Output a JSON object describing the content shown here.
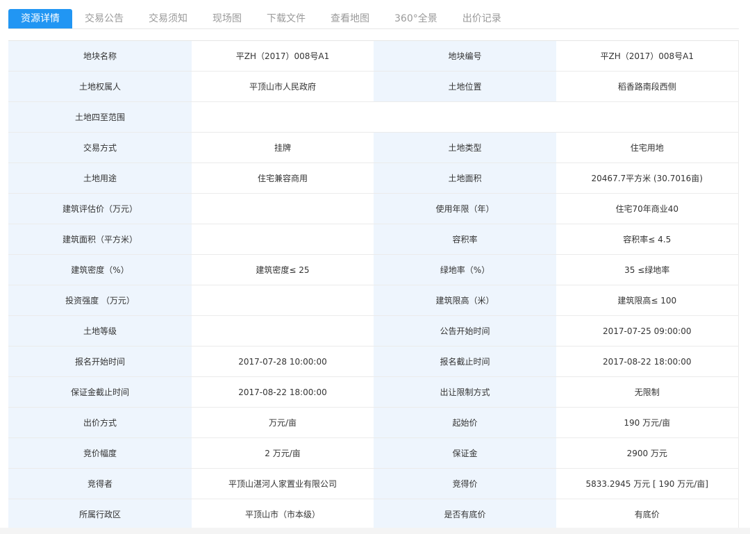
{
  "tabs": [
    {
      "label": "资源详情"
    },
    {
      "label": "交易公告"
    },
    {
      "label": "交易须知"
    },
    {
      "label": "现场图"
    },
    {
      "label": "下载文件"
    },
    {
      "label": "查看地图"
    },
    {
      "label": "360°全景"
    },
    {
      "label": "出价记录"
    }
  ],
  "active_tab": "资源详情",
  "colors": {
    "accent": "#2196f3",
    "label_bg": "#eef5fd"
  },
  "rows": [
    {
      "l1": "地块名称",
      "v1": "平ZH（2017）008号A1",
      "l2": "地块编号",
      "v2": "平ZH（2017）008号A1"
    },
    {
      "l1": "土地权属人",
      "v1": "平顶山市人民政府",
      "l2": "土地位置",
      "v2": "稻香路南段西侧"
    },
    {
      "l1": "土地四至范围",
      "v1": ""
    },
    {
      "l1": "交易方式",
      "v1": "挂牌",
      "l2": "土地类型",
      "v2": "住宅用地"
    },
    {
      "l1": "土地用途",
      "v1": "住宅兼容商用",
      "l2": "土地面积",
      "v2": "20467.7平方米 (30.7016亩)"
    },
    {
      "l1": "建筑评估价（万元）",
      "v1": "",
      "l2": "使用年限（年）",
      "v2": "住宅70年商业40"
    },
    {
      "l1": "建筑面积（平方米）",
      "v1": "",
      "l2": "容积率",
      "v2": "容积率≤ 4.5"
    },
    {
      "l1": "建筑密度（%）",
      "v1": "建筑密度≤ 25",
      "l2": "绿地率（%）",
      "v2": "35 ≤绿地率"
    },
    {
      "l1": "投资强度 （万元）",
      "v1": "",
      "l2": "建筑限高（米）",
      "v2": "建筑限高≤ 100"
    },
    {
      "l1": "土地等级",
      "v1": "",
      "l2": "公告开始时间",
      "v2": "2017-07-25 09:00:00"
    },
    {
      "l1": "报名开始时间",
      "v1": "2017-07-28 10:00:00",
      "l2": "报名截止时间",
      "v2": "2017-08-22 18:00:00"
    },
    {
      "l1": "保证金截止时间",
      "v1": "2017-08-22 18:00:00",
      "l2": "出让限制方式",
      "v2": "无限制"
    },
    {
      "l1": "出价方式",
      "v1": "万元/亩",
      "l2": "起始价",
      "v2": "190 万元/亩"
    },
    {
      "l1": "竞价幅度",
      "v1": "2 万元/亩",
      "l2": "保证金",
      "v2": "2900 万元"
    },
    {
      "l1": "竞得者",
      "v1": "平顶山湛河人家置业有限公司",
      "l2": "竞得价",
      "v2": "5833.2945 万元 [ 190 万元/亩]"
    },
    {
      "l1": "所属行政区",
      "v1": "平顶山市（市本级）",
      "l2": "是否有底价",
      "v2": "有底价"
    }
  ]
}
